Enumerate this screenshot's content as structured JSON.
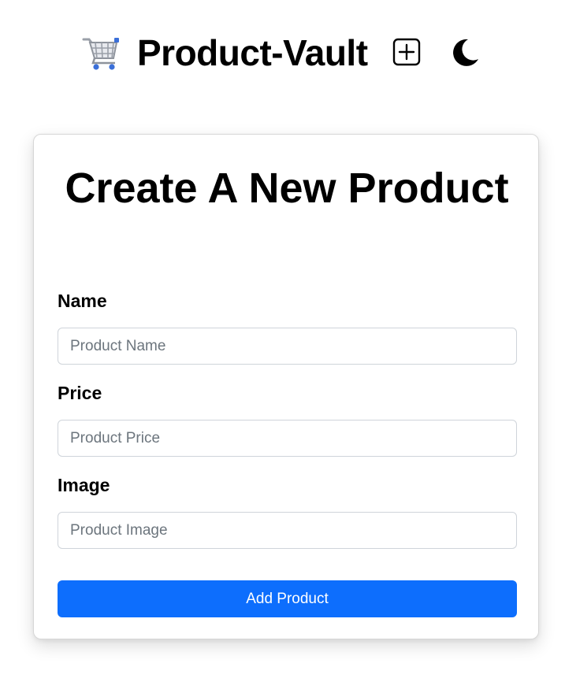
{
  "header": {
    "brand_title": "Product-Vault",
    "cart_icon": "shopping-cart-icon",
    "add_icon": "plus-square-icon",
    "theme_icon": "moon-icon"
  },
  "form": {
    "title": "Create A New Product",
    "fields": [
      {
        "label": "Name",
        "placeholder": "Product Name",
        "value": ""
      },
      {
        "label": "Price",
        "placeholder": "Product Price",
        "value": ""
      },
      {
        "label": "Image",
        "placeholder": "Product Image",
        "value": ""
      }
    ],
    "submit_label": "Add Product"
  },
  "colors": {
    "primary": "#0d6efd",
    "text": "#000000",
    "placeholder": "#6c757d",
    "border": "#cfd4da"
  }
}
